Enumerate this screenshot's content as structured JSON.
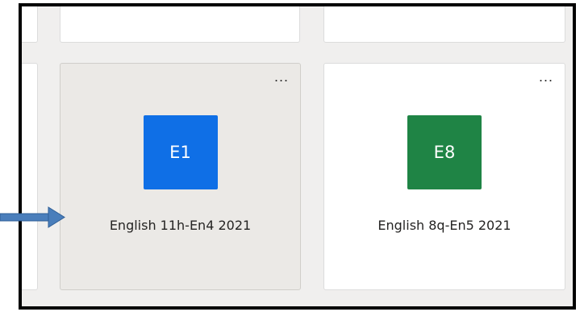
{
  "teams": [
    {
      "initials": "E1",
      "name": "English 11h-En4 2021",
      "color": "#0f6fe6",
      "more_label": "..."
    },
    {
      "initials": "E8",
      "name": "English 8q-En5 2021",
      "color": "#1f8445",
      "more_label": "..."
    }
  ],
  "annotation": {
    "arrow_color": "#4a7ebb",
    "frame_color": "#000000"
  }
}
